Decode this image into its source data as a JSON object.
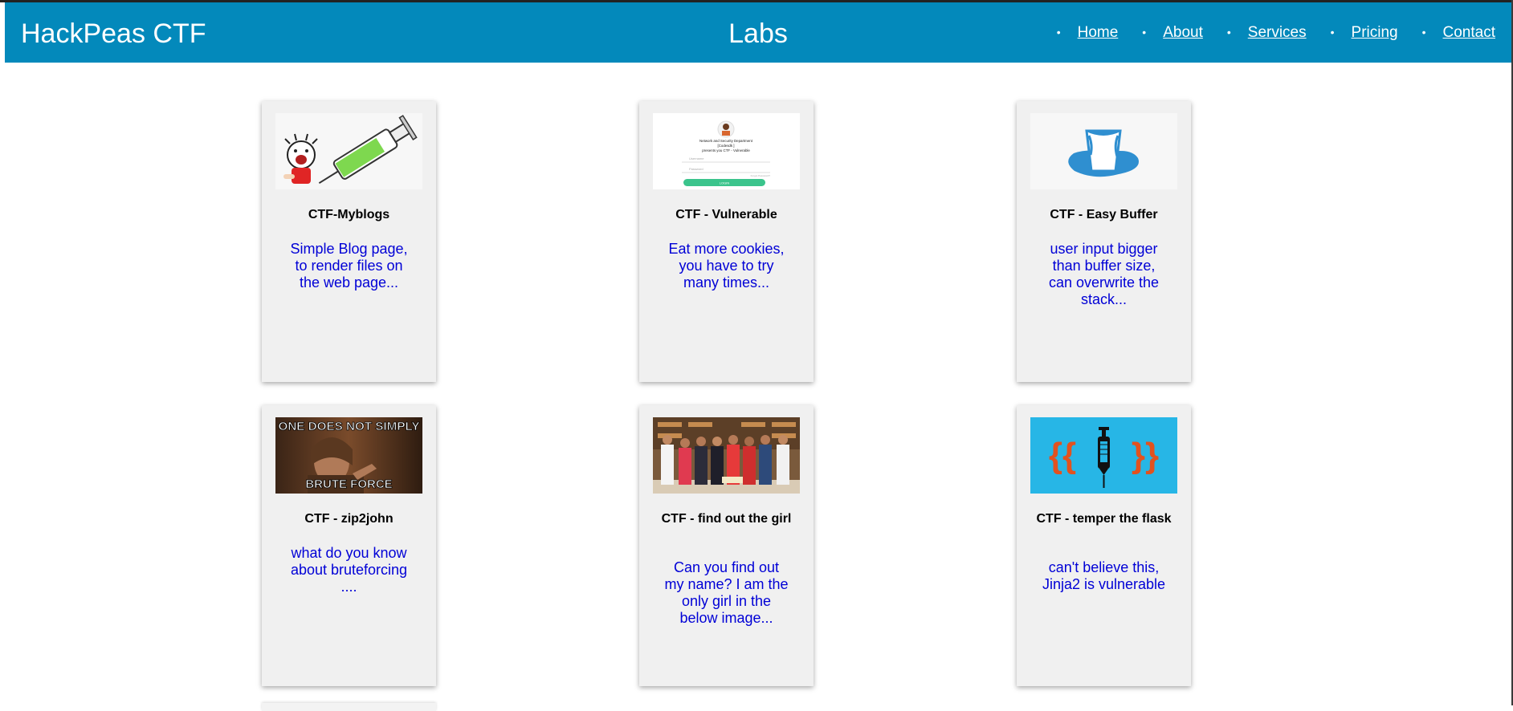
{
  "header": {
    "brand": "HackPeas CTF",
    "heading": "Labs",
    "nav": [
      "Home",
      "About",
      "Services",
      "Pricing",
      "Contact"
    ],
    "bg_color": "#0389bb"
  },
  "cards": [
    {
      "title": "CTF-Myblogs",
      "description": "Simple Blog page, to render files on the web page...",
      "image": "cartoon-syringe-image"
    },
    {
      "title": "CTF - Vulnerable",
      "description": "Eat more cookies, you have to try many times...",
      "image": "login-page-screenshot",
      "login": {
        "org": "Network and Security Department",
        "org2": "[Codesdk ]",
        "presents": "presents you CTF - Vulnerable",
        "username": "Username",
        "password": "Password",
        "forgot": "Forgot Password?",
        "button": "LOGIN"
      }
    },
    {
      "title": "CTF - Easy Buffer",
      "description": "user input bigger than buffer size, can overwrite the stack...",
      "image": "overflowing-cup-image"
    },
    {
      "title": "CTF - zip2john",
      "description": "what do you know about bruteforcing ....",
      "image": "meme-image",
      "meme": {
        "top": "ONE DOES NOT SIMPLY",
        "bottom": "BRUTE FORCE"
      }
    },
    {
      "title": "CTF - find out the girl",
      "description": "Can you find out my name? I am the only girl in the below image...",
      "image": "group-photo-image"
    },
    {
      "title": "CTF - temper the flask",
      "description": "can't believe this, Jinja2 is vulnerable",
      "image": "template-injection-image",
      "braces": {
        "left": "{{",
        "right": "}}"
      }
    }
  ]
}
